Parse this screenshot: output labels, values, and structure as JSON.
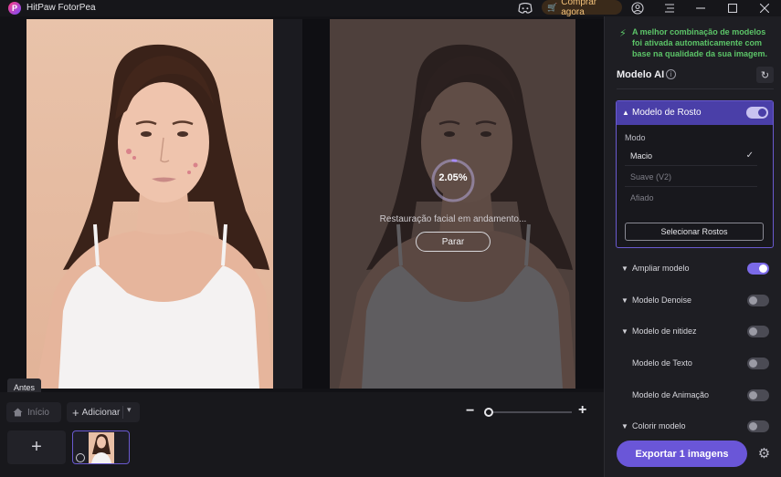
{
  "app": {
    "title": "HitPaw FotorPea",
    "logo_letter": "P"
  },
  "titlebar": {
    "buy_label": "Comprar agora"
  },
  "preview": {
    "progress_text": "2.05%",
    "progress_fraction": 0.0205,
    "status_text": "Restauração facial em andamento...",
    "stop_label": "Parar",
    "before_label": "Antes"
  },
  "bottom": {
    "home_label": "Início",
    "add_label": "Adicionar",
    "zoom_fraction": 0.0
  },
  "sidebar": {
    "notice": "A melhor combinação de modelos foi ativada automaticamente com base na qualidade da sua imagem.",
    "model_ai_title": "Modelo AI",
    "face_model": {
      "label": "Modelo de Rosto",
      "enabled": true,
      "mode_label": "Modo",
      "options": [
        {
          "label": "Macio",
          "selected": true
        },
        {
          "label": "Suave (V2)",
          "selected": false
        },
        {
          "label": "Afiado",
          "selected": false
        }
      ],
      "select_faces_label": "Selecionar Rostos"
    },
    "models": [
      {
        "label": "Ampliar modelo",
        "enabled": true,
        "expandable": true
      },
      {
        "label": "Modelo Denoise",
        "enabled": false,
        "expandable": true
      },
      {
        "label": "Modelo de nitidez",
        "enabled": false,
        "expandable": true
      },
      {
        "label": "Modelo de Texto",
        "enabled": false,
        "expandable": false
      },
      {
        "label": "Modelo de Animação",
        "enabled": false,
        "expandable": false
      },
      {
        "label": "Colorir modelo",
        "enabled": false,
        "expandable": true
      }
    ],
    "export_label": "Exportar 1 imagens"
  },
  "colors": {
    "accent": "#6a56d8",
    "notice_green": "#5cc468",
    "buy_text": "#f4c27a"
  }
}
